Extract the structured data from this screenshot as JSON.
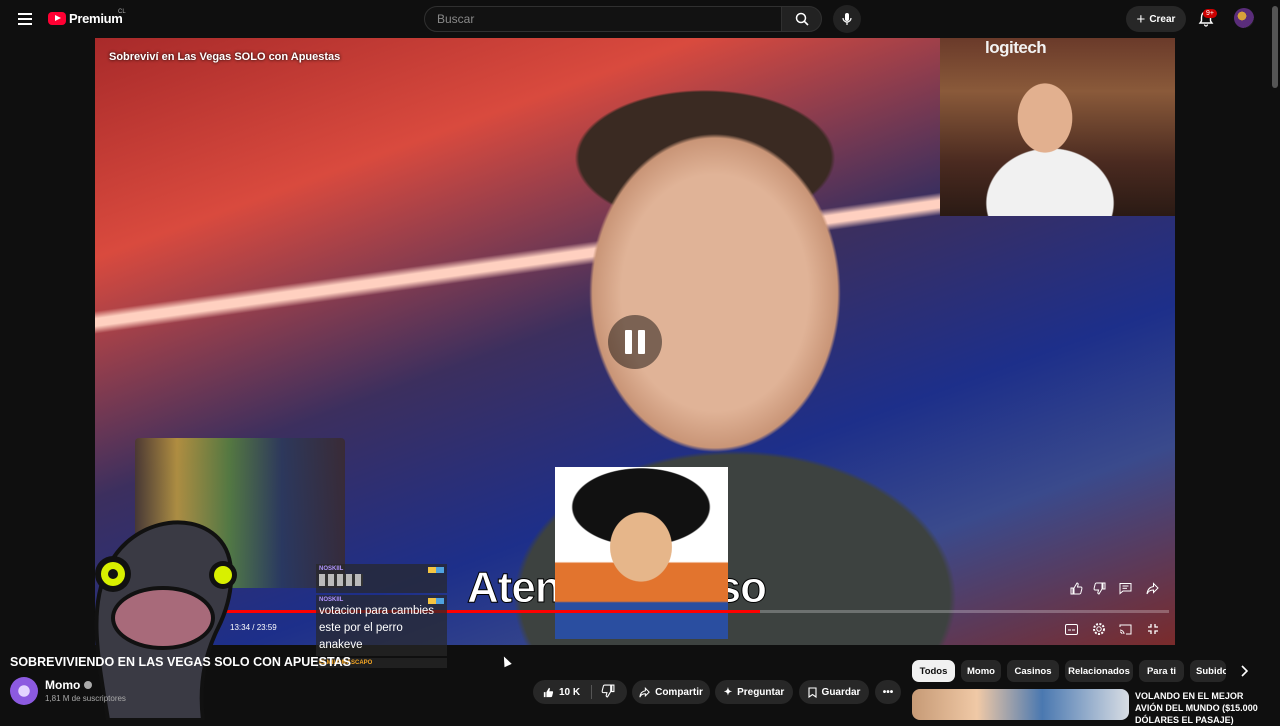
{
  "header": {
    "menu_icon": "hamburger-menu-icon",
    "logo_text": "Premium",
    "logo_country": "CL",
    "search_placeholder": "Buscar",
    "create_label": "Crear",
    "notifications_badge": "9+"
  },
  "player": {
    "title_overlay": "Sobreviví en Las Vegas SOLO con Apuestas",
    "webcam_brand": "logitech",
    "caption": "Atención a eso",
    "time_display": "13:34 / 23:59",
    "progress_fraction": 0.567
  },
  "chat": {
    "messages": [
      {
        "name": "NOSKIIL",
        "text": ""
      },
      {
        "name": "NOSKIIL",
        "text": "votacion para cambies este por el perro anakeve"
      },
      {
        "name": "ELMILOMASCAPO",
        "text": ""
      }
    ]
  },
  "meta": {
    "video_title": "SOBREVIVIENDO EN LAS VEGAS SOLO CON APUESTAS",
    "channel_name": "Momo",
    "subscribers": "1,81 M de suscriptores",
    "like_count": "10 K",
    "share_label": "Compartir",
    "ask_label": "Preguntar",
    "save_label": "Guardar"
  },
  "chips": [
    "Todos",
    "Momo",
    "Casinos",
    "Relacionados",
    "Para ti",
    "Subidos"
  ],
  "recommendation": {
    "title": "VOLANDO EN EL MEJOR AVIÓN DEL MUNDO ($15.000 DÓLARES EL PASAJE)"
  },
  "colors": {
    "background": "#0f0f0f",
    "accent_red": "#ff0000",
    "pill": "#272727"
  }
}
